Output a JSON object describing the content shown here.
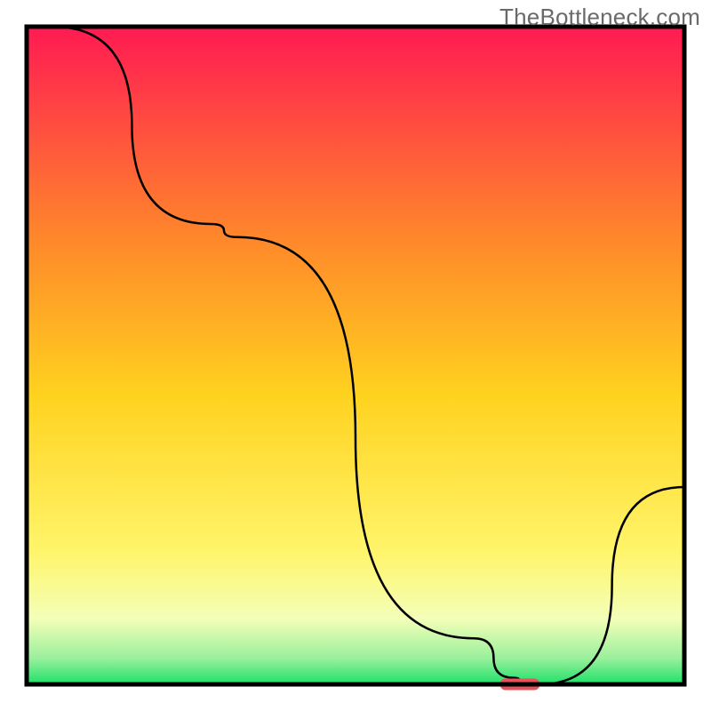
{
  "watermark": "TheBottleneck.com",
  "colors": {
    "gradient_top": "#ff1a52",
    "gradient_upper_mid": "#ff8a2a",
    "gradient_mid": "#ffd21f",
    "gradient_lower_mid": "#fff56b",
    "gradient_low": "#f4ffb8",
    "gradient_green_light": "#9af09c",
    "gradient_green": "#1fe06a",
    "line": "#000000",
    "border": "#000000",
    "marker": "#e5535b"
  },
  "chart_data": {
    "type": "line",
    "title": "",
    "xlabel": "",
    "ylabel": "",
    "xlim": [
      0,
      100
    ],
    "ylim": [
      0,
      100
    ],
    "x": [
      0,
      4,
      28,
      32,
      68,
      74,
      76,
      78,
      100
    ],
    "values": [
      100,
      100,
      70,
      68,
      7,
      1,
      0,
      0,
      30
    ],
    "marker": {
      "x_center": 75,
      "width": 6,
      "y": 0
    },
    "grid": false,
    "legend": null
  }
}
